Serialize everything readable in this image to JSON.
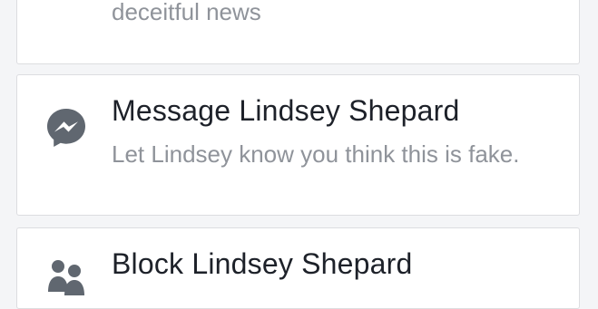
{
  "options": [
    {
      "id": "report",
      "icon": "flag-icon",
      "title": "",
      "description": "Let us know if this is purposefully fake or deceitful news"
    },
    {
      "id": "message",
      "icon": "messenger-icon",
      "title": "Message Lindsey Shepard",
      "description": "Let Lindsey know you think this is fake."
    },
    {
      "id": "block",
      "icon": "person-block-icon",
      "title": "Block Lindsey Shepard",
      "description": ""
    }
  ],
  "colors": {
    "title_text": "#1d2129",
    "description_text": "#8f939a",
    "icon_gray": "#606770",
    "card_border": "#dcdde0",
    "background": "#f4f5f7"
  }
}
